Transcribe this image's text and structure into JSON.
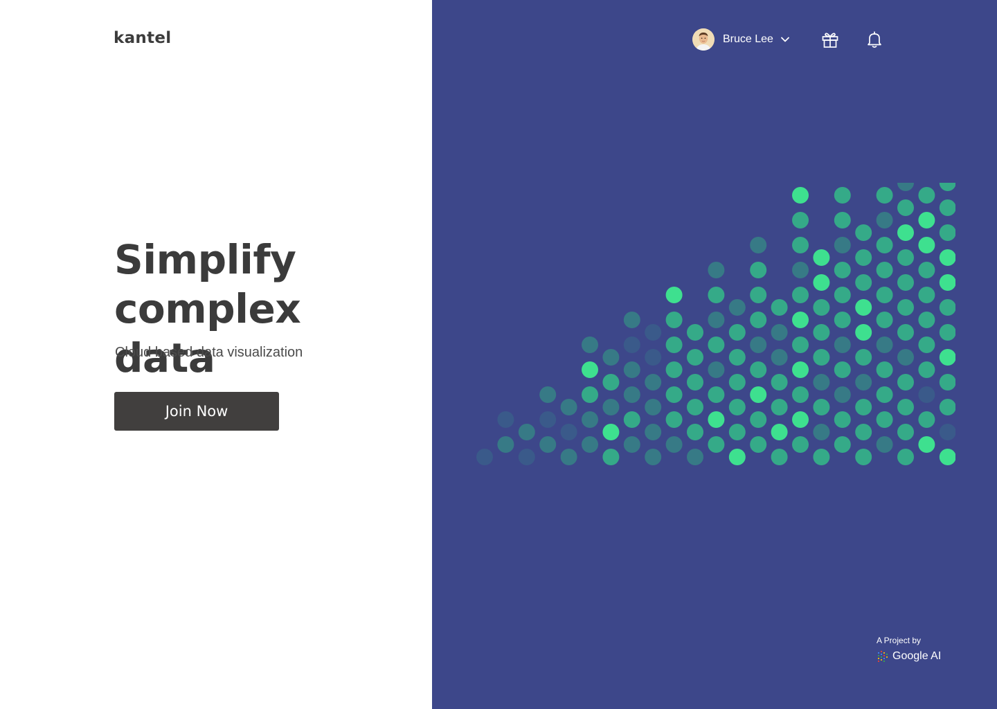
{
  "brand": {
    "logo_text": "kantel"
  },
  "hero": {
    "headline_line1": "Simplify",
    "headline_line2": "complex data",
    "subtitle": "Cloud based data visualization",
    "cta_label": "Join Now"
  },
  "header": {
    "user_name": "Bruce Lee",
    "icons": [
      "gift-icon",
      "bell-icon",
      "chevron-down-icon"
    ]
  },
  "footer": {
    "credit_label": "A Project by",
    "credit_brand": "Google AI"
  },
  "colors": {
    "panel_bg": "#3d478a",
    "button_bg": "#413f3e",
    "text_dark": "#3b3b3b",
    "dot_bright": "#3ee08f",
    "dot_mid": "#35aa88",
    "dot_dim": "#377a86",
    "dot_faint": "#3a5a8a"
  },
  "chart_data": {
    "type": "scatter",
    "columns": [
      {
        "column": 1,
        "dots": [
          0
        ]
      },
      {
        "column": 2,
        "dots": [
          1,
          0
        ]
      },
      {
        "column": 3,
        "dots": [
          0,
          1
        ]
      },
      {
        "column": 4,
        "dots": [
          1,
          0,
          1
        ]
      },
      {
        "column": 5,
        "dots": [
          1,
          0,
          1
        ]
      },
      {
        "column": 6,
        "dots": [
          1,
          1,
          2,
          3,
          1
        ]
      },
      {
        "column": 7,
        "dots": [
          2,
          3,
          1,
          2,
          1
        ]
      },
      {
        "column": 8,
        "dots": [
          1,
          2,
          1,
          1,
          0,
          1
        ]
      },
      {
        "column": 9,
        "dots": [
          1,
          1,
          1,
          1,
          0,
          0
        ]
      },
      {
        "column": 10,
        "dots": [
          1,
          2,
          2,
          2,
          2,
          2,
          3
        ]
      },
      {
        "column": 11,
        "dots": [
          1,
          2,
          2,
          2,
          2,
          2
        ]
      },
      {
        "column": 12,
        "dots": [
          2,
          3,
          2,
          1,
          2,
          1,
          2,
          1
        ]
      },
      {
        "column": 13,
        "dots": [
          3,
          2,
          2,
          2,
          2,
          2,
          1
        ]
      },
      {
        "column": 14,
        "dots": [
          2,
          2,
          3,
          2,
          1,
          2,
          2,
          2,
          1
        ]
      },
      {
        "column": 15,
        "dots": [
          2,
          3,
          2,
          2,
          1,
          1,
          2
        ]
      },
      {
        "column": 16,
        "dots": [
          2,
          3,
          2,
          3,
          2,
          3,
          2,
          1,
          2,
          2,
          3
        ]
      },
      {
        "column": 17,
        "dots": [
          2,
          1,
          2,
          1,
          2,
          2,
          2,
          3,
          3
        ]
      },
      {
        "column": 18,
        "dots": [
          2,
          2,
          1,
          2,
          1,
          2,
          2,
          2,
          1,
          2,
          2,
          2
        ]
      },
      {
        "column": 19,
        "dots": [
          2,
          2,
          2,
          1,
          2,
          3,
          3,
          2,
          2,
          2
        ]
      },
      {
        "column": 20,
        "dots": [
          1,
          2,
          2,
          2,
          1,
          2,
          2,
          2,
          2,
          1,
          2
        ]
      },
      {
        "column": 21,
        "dots": [
          2,
          2,
          2,
          2,
          1,
          2,
          2,
          2,
          2,
          3,
          2,
          1
        ]
      },
      {
        "column": 22,
        "dots": [
          3,
          2,
          0,
          2,
          2,
          2,
          2,
          2,
          3,
          3,
          2,
          2,
          2
        ]
      },
      {
        "column": 23,
        "dots": [
          3,
          0,
          2,
          2,
          3,
          2,
          2,
          3,
          3,
          2,
          2,
          2
        ]
      }
    ],
    "intensity_levels": [
      "faint",
      "dim",
      "mid",
      "bright"
    ]
  }
}
